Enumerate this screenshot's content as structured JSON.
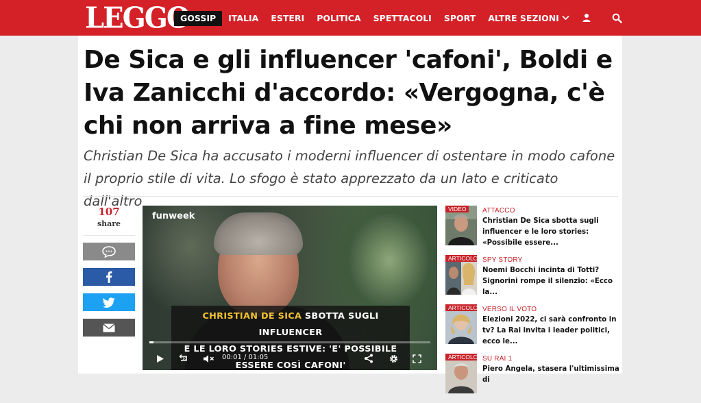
{
  "header": {
    "logo_text": "LEGGO",
    "nav": [
      {
        "label": "GOSSIP",
        "active": true
      },
      {
        "label": "ITALIA",
        "active": false
      },
      {
        "label": "ESTERI",
        "active": false
      },
      {
        "label": "POLITICA",
        "active": false
      },
      {
        "label": "SPETTACOLI",
        "active": false
      },
      {
        "label": "SPORT",
        "active": false
      },
      {
        "label": "ALTRE SEZIONI",
        "active": false
      }
    ],
    "icons": [
      "user-icon",
      "search-icon"
    ],
    "brand_color": "#d42027"
  },
  "article": {
    "headline": "De Sica e gli influencer 'cafoni', Boldi e Iva Zanicchi d'accordo: «Vergogna, c'è chi non arriva a fine mese»",
    "subtitle": "Christian De Sica ha accusato i moderni influencer di ostentare in modo cafone il proprio stile di vita. Lo sfogo è stato apprezzato da un lato e criticato dall'altro"
  },
  "share": {
    "count": "107",
    "label": "share",
    "buttons": [
      "comment-icon",
      "facebook-icon",
      "twitter-icon",
      "mail-icon"
    ]
  },
  "video": {
    "brand": "funweek",
    "caption_highlight": "CHRISTIAN DE SICA",
    "caption_line1_rest": " SBOTTA SUGLI INFLUENCER",
    "caption_line2": "E LE LORO STORIES ESTIVE: 'E' POSSIBILE",
    "caption_line3": "ESSERE COSÌ CAFONI'",
    "time": "00:01 / 01:05",
    "progress": 0.015
  },
  "related": [
    {
      "badge": "VIDEO",
      "category": "ATTACCO",
      "title": "Christian De Sica sbotta sugli influencer e le loro stories: «Possibile essere..."
    },
    {
      "badge": "ARTICOLO",
      "category": "SPY STORY",
      "title": "Noemi Bocchi incinta di Totti? Signorini rompe il silenzio: «Ecco la..."
    },
    {
      "badge": "ARTICOLO",
      "category": "VERSO IL VOTO",
      "title": "Elezioni 2022, ci sarà confronto in tv? La Rai invita i leader politici, ecco le..."
    },
    {
      "badge": "ARTICOLO",
      "category": "SU RAI 1",
      "title": "Piero Angela, stasera l'ultimissima di"
    }
  ]
}
